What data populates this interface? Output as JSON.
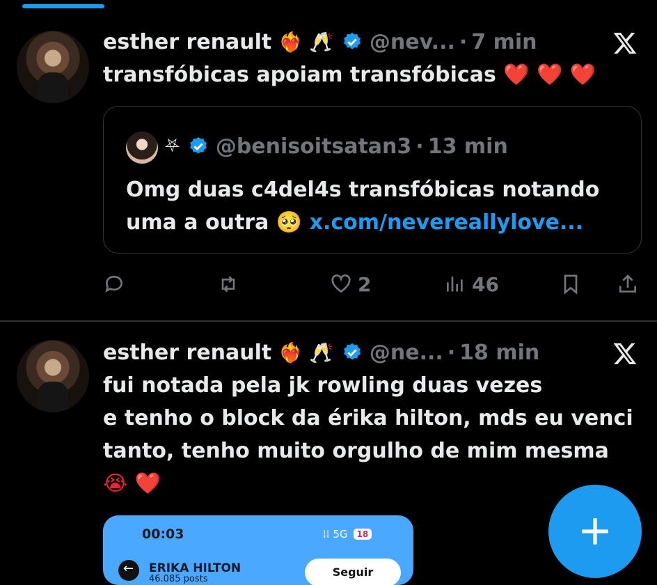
{
  "tweets": [
    {
      "author": "esther renault",
      "emojis": "❤️‍🔥 🥂",
      "handle": "@nev...",
      "dot": "·",
      "time": "7 min",
      "text": "transfóbicas apoiam transfóbicas",
      "text_emojis": "❤️ ❤️ ❤️",
      "quote": {
        "author_symbol": "⛧",
        "handle": "@benisoitsatan3",
        "dot": "·",
        "time": "13 min",
        "text_line1": "Omg duas c4del4s transfóbicas notando",
        "text_line2": "uma a outra",
        "text_emoji": "🥺",
        "link": "x.com/nevereallylove..."
      },
      "actions": {
        "replies": "",
        "retweets": "",
        "likes": "2",
        "views": "46"
      }
    },
    {
      "author": "esther renault",
      "emojis": "❤️‍🔥 🥂",
      "handle": "@ne...",
      "dot": "·",
      "time": "18 min",
      "text_line1": "fui notada pela jk rowling duas vezes",
      "text_line2": "e tenho o block da érika hilton, mds eu venci",
      "text_line3": "tanto, tenho muito orgulho de mim mesma",
      "text_line4": "😭 ❤️",
      "media": {
        "status_time": "00:03",
        "network": "5G",
        "battery": "18",
        "profile_name": "ERIKA HILTON",
        "profile_posts": "46.085 posts",
        "follow_button": "Seguir"
      }
    }
  ],
  "colors": {
    "background": "#000000",
    "accent": "#1d9bf0",
    "muted": "#71767b",
    "heart": "#f4212e"
  },
  "icons": [
    "verified-badge-icon",
    "x-logo-icon",
    "reply-icon",
    "retweet-icon",
    "like-icon",
    "views-icon",
    "bookmark-icon",
    "share-icon",
    "compose-plus-icon"
  ]
}
